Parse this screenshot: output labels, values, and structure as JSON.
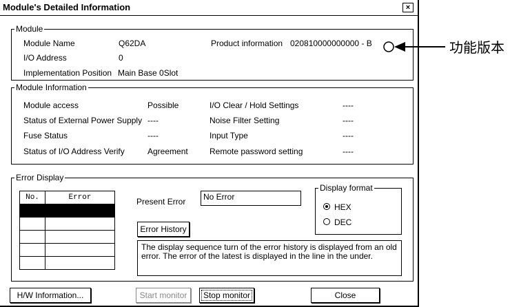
{
  "window": {
    "title": "Module's Detailed Information",
    "close_symbol": "×"
  },
  "module": {
    "legend": "Module",
    "name_label": "Module Name",
    "name_value": "Q62DA",
    "io_label": "I/O Address",
    "io_value": "0",
    "impl_label": "Implementation Position",
    "impl_value": "Main Base  0Slot",
    "product_label": "Product information",
    "product_value": "020810000000000 - B"
  },
  "module_info": {
    "legend": "Module Information",
    "rows": [
      {
        "label": "Module access",
        "value": "Possible",
        "label2": "I/O Clear / Hold Settings",
        "value2": "----"
      },
      {
        "label": "Status of External Power Supply",
        "value": "----",
        "label2": "Noise Filter Setting",
        "value2": "----"
      },
      {
        "label": "Fuse Status",
        "value": "----",
        "label2": "Input Type",
        "value2": "----"
      },
      {
        "label": "Status of I/O Address Verify",
        "value": "Agreement",
        "label2": "Remote password setting",
        "value2": "----"
      }
    ]
  },
  "error_display": {
    "legend": "Error Display",
    "table_headers": [
      "No.",
      "Error"
    ],
    "present_error_label": "Present Error",
    "present_error_value": "No Error",
    "history_button": "Error History",
    "note": "The display sequence turn of the error history is displayed from an old error. The error of the latest is displayed in the line in the under.",
    "format": {
      "legend": "Display format",
      "hex": "HEX",
      "dec": "DEC",
      "selected": "HEX"
    }
  },
  "buttons": {
    "hw_info": "H/W Information...",
    "start_monitor": "Start monitor",
    "stop_monitor": "Stop monitor",
    "close": "Close"
  },
  "callout": {
    "text": "功能版本"
  }
}
